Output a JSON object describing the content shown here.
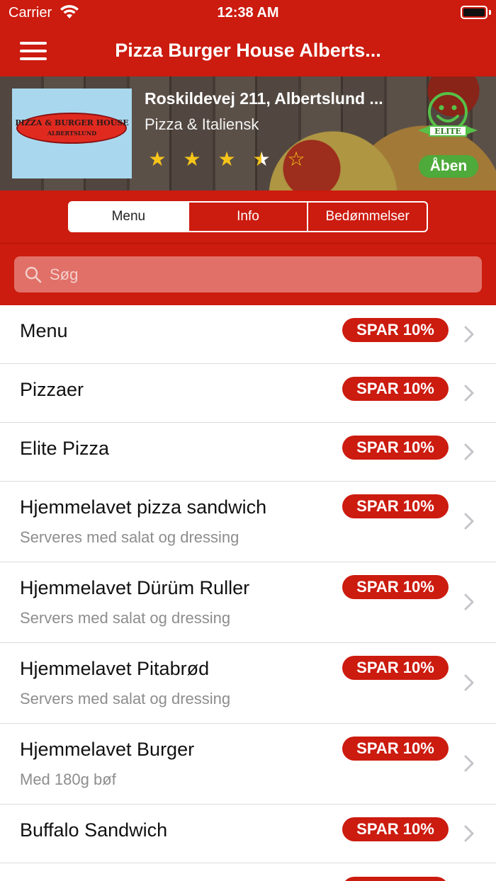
{
  "status_bar": {
    "carrier": "Carrier",
    "time": "12:38 AM"
  },
  "navbar": {
    "title": "Pizza Burger House Alberts..."
  },
  "restaurant": {
    "logo_line1": "PIZZA & BURGER HOUSE",
    "logo_line2": "ALBERTSLUND",
    "address": "Roskildevej 211, Albertslund ...",
    "category": "Pizza & Italiensk",
    "rating": 3.5,
    "rating_max": 5,
    "elite_label": "ELITE",
    "open_status": "Åben"
  },
  "tabs": [
    {
      "label": "Menu",
      "active": true
    },
    {
      "label": "Info",
      "active": false
    },
    {
      "label": "Bedømmelser",
      "active": false
    }
  ],
  "search": {
    "placeholder": "Søg"
  },
  "menu_items": [
    {
      "name": "Menu",
      "description": "",
      "badge": "SPAR 10%"
    },
    {
      "name": "Pizzaer",
      "description": "",
      "badge": "SPAR 10%"
    },
    {
      "name": "Elite Pizza",
      "description": "",
      "badge": "SPAR 10%"
    },
    {
      "name": "Hjemmelavet pizza sandwich",
      "description": "Serveres med salat og dressing",
      "badge": "SPAR 10%"
    },
    {
      "name": "Hjemmelavet Dürüm Ruller",
      "description": "Servers med salat og dressing",
      "badge": "SPAR 10%"
    },
    {
      "name": "Hjemmelavet Pitabrød",
      "description": "Servers med salat og dressing",
      "badge": "SPAR 10%"
    },
    {
      "name": "Hjemmelavet Burger",
      "description": "Med 180g bøf",
      "badge": "SPAR 10%"
    },
    {
      "name": "Buffalo Sandwich",
      "description": "",
      "badge": "SPAR 10%"
    }
  ],
  "colors": {
    "brand_red": "#cc1b0f",
    "open_green": "#4eaa3a",
    "star_yellow": "#f6c51a"
  }
}
